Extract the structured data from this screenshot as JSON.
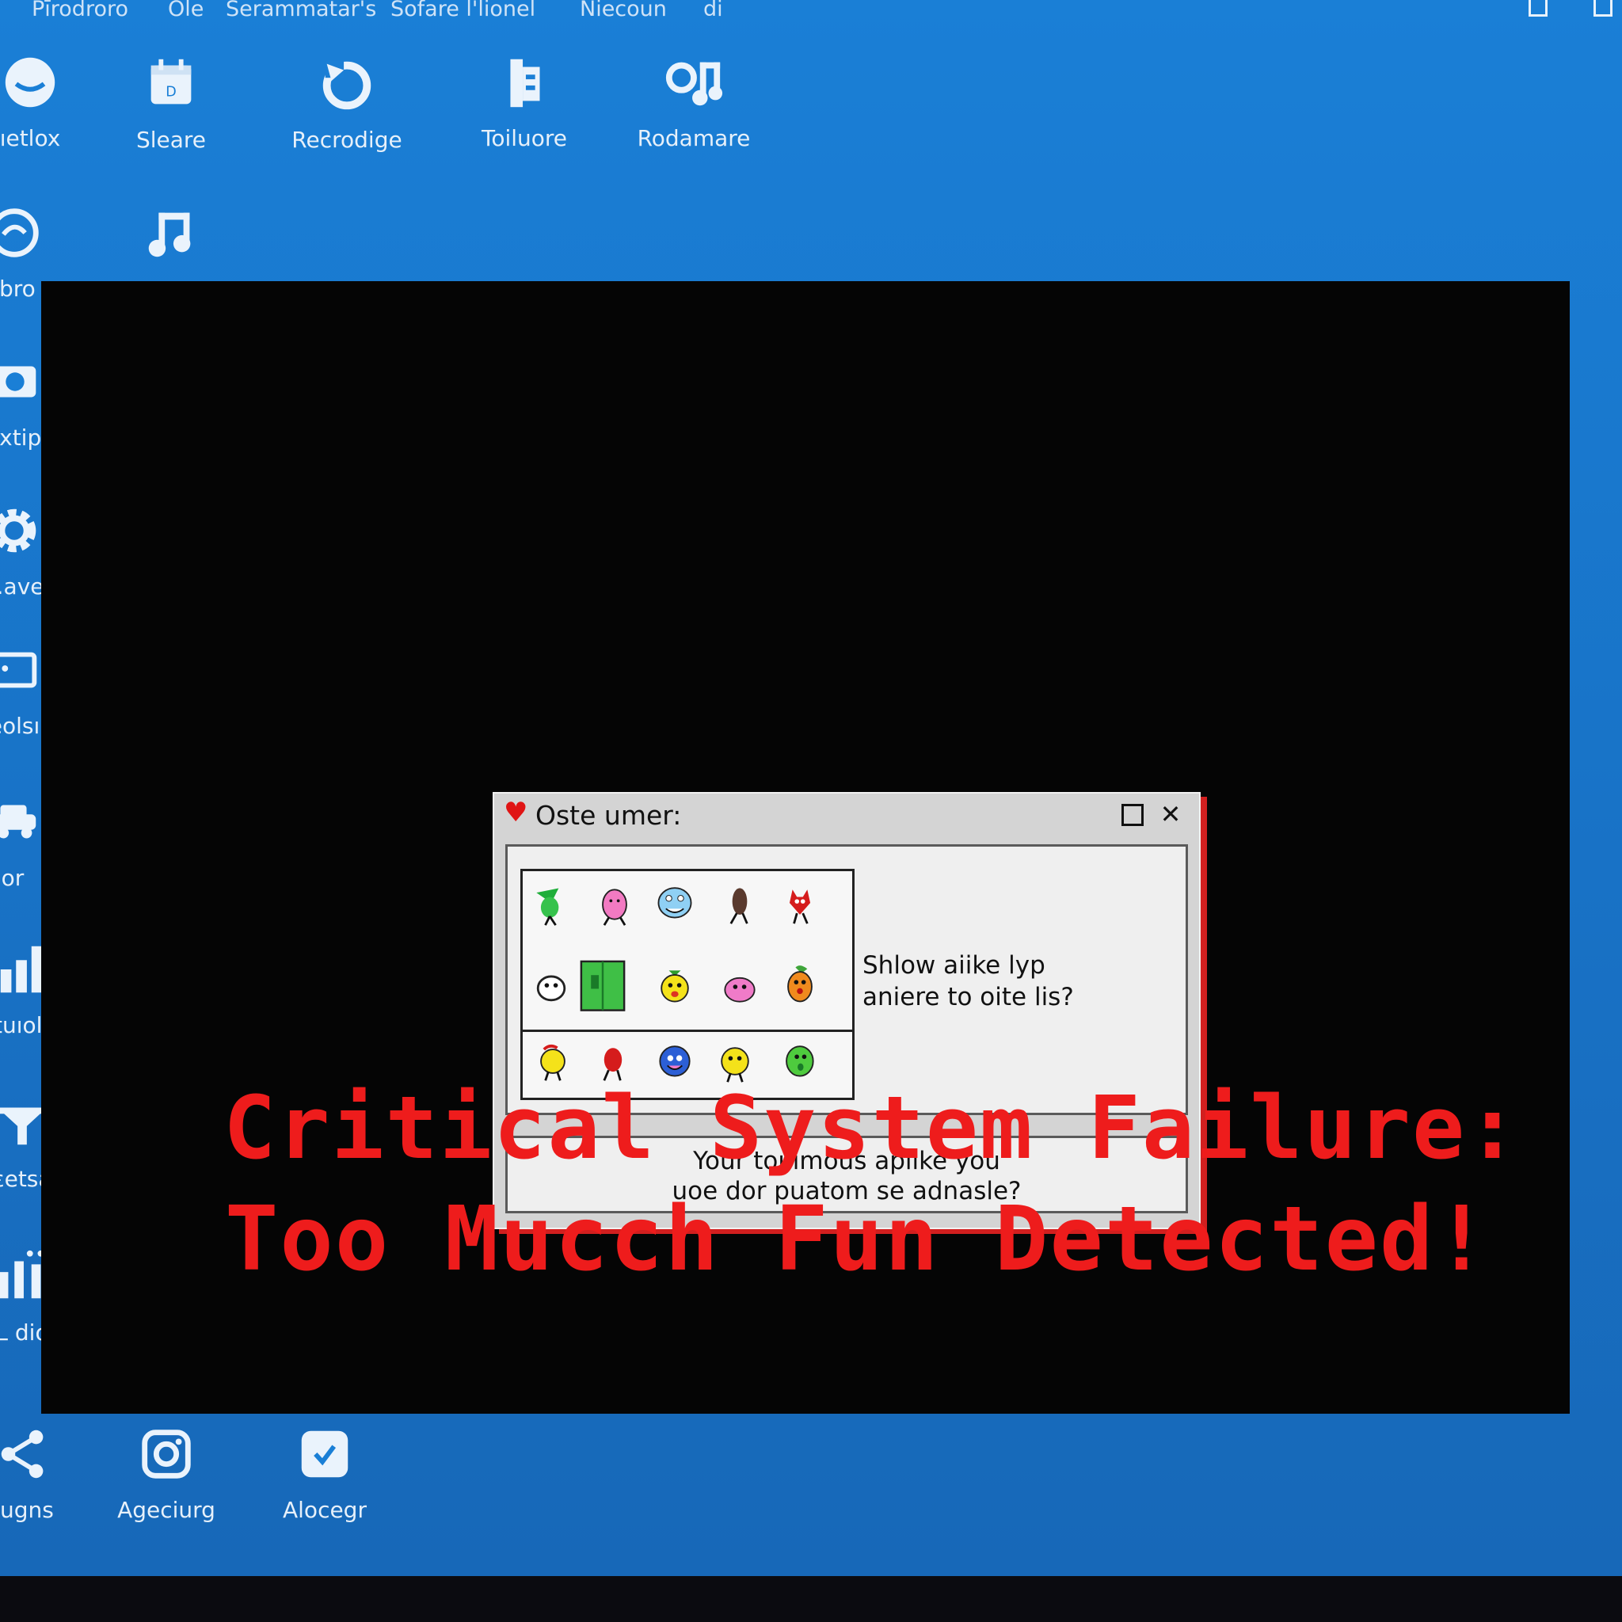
{
  "menubar": {
    "items": [
      "Pīrodroro",
      "Ole",
      "Serammatar's",
      "Sofare l'lionel",
      "Niecoun",
      "di"
    ]
  },
  "desktop_icons": {
    "row1": [
      {
        "label": "ıetlox",
        "icon": "partial-circle-icon"
      },
      {
        "label": "Sleare",
        "icon": "calendar-icon"
      },
      {
        "label": "Recrodige",
        "icon": "refresh-icon"
      },
      {
        "label": "Toiluore",
        "icon": "tools-icon"
      },
      {
        "label": "Rodamare",
        "icon": "music-search-icon"
      }
    ],
    "row2": [
      {
        "label": "ibro",
        "icon": "globe-icon"
      },
      {
        "label": "",
        "icon": "music-note-icon"
      }
    ],
    "left_column": [
      {
        "label": "ɔxtip",
        "icon": "camera-icon"
      },
      {
        "label": "ɛ.ave",
        "icon": "gear-icon"
      },
      {
        "label": "eolsı",
        "icon": "window-icon"
      },
      {
        "label": "or",
        "icon": "car-icon"
      },
      {
        "label": "tuıols",
        "icon": "bar-chart-icon"
      },
      {
        "label": "ɛetsa",
        "icon": "funnel-icon"
      },
      {
        "label": "L dio",
        "icon": "info-bars-icon"
      }
    ],
    "bottom_row": [
      {
        "label": "ıugns",
        "icon": "share-icon"
      },
      {
        "label": "Ageciurg",
        "icon": "instagram-icon"
      },
      {
        "label": "Alocegr",
        "icon": "checkbox-icon"
      }
    ]
  },
  "dialog": {
    "title": "Oste umer:",
    "question_line1": "Shlow aiike lyp",
    "question_line2": "aniere to oite lis?",
    "footer_line1": "Your toı imous aplike you",
    "footer_line2": "uoe dor puatom se adnasle?"
  },
  "error": {
    "line1": "Critical System Failure:",
    "line2": "Too Mucch Fun Detected!"
  },
  "colors": {
    "desktop_blue": "#1979cf",
    "alert_red": "#ee1c1c",
    "screen_black": "#050505",
    "dialog_gray": "#d4d4d4"
  }
}
